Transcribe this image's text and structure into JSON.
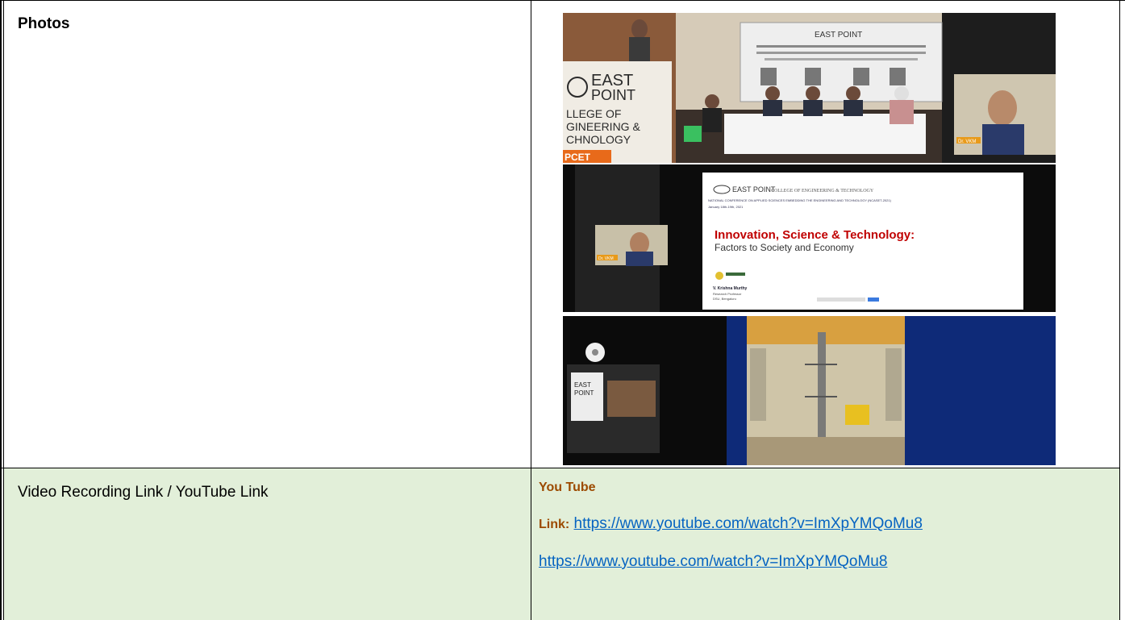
{
  "rows": {
    "photos": {
      "label": "Photos"
    },
    "video": {
      "label": "Video Recording Link / YouTube Link",
      "heading": "You Tube",
      "link_prefix": "Link:",
      "url1": "https://www.youtube.com/watch?v=ImXpYMQoMu8",
      "url2": "https://www.youtube.com/watch?v=ImXpYMQoMu8"
    }
  },
  "photo1": {
    "banner_logo": "EAST POINT",
    "sign_lines": [
      "EAST",
      "POINT",
      "LLEGE OF",
      "GINEERING &",
      "CHNOLOGY"
    ],
    "sign_footer": "PCET",
    "inset_label": "Dr. VKM"
  },
  "photo2": {
    "logo": "EAST POINT",
    "college": "COLLEGE OF ENGINEERING & TECHNOLOGY",
    "conference": "NATIONAL CONFERENCE ON APPLIED SCIENCES EMBEDDING THE ENGINEERING AND TECHNOLOGY (NCASET-2021)",
    "dates": "January 18th-19th, 2021",
    "title": "Innovation, Science & Technology:",
    "subtitle": "Factors to Society and Economy",
    "speaker_name": "V. Krishna Murthy",
    "speaker_role": "Research Professor",
    "speaker_org": "DSU, Bengaluru",
    "inset_label": "Dr. VKM"
  },
  "photo3": {
    "sign_lines": [
      "EAST",
      "POINT"
    ]
  },
  "colors": {
    "row_highlight": "#e2efd9",
    "label_brown": "#9c4a00",
    "link_blue": "#0563c1",
    "slide_red": "#c00000"
  }
}
